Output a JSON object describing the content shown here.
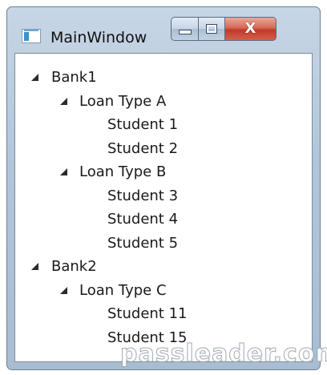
{
  "window": {
    "title": "MainWindow",
    "icon": "app-window-icon",
    "buttons": {
      "minimize": "minimize-icon",
      "maximize": "maximize-icon",
      "close": "close-icon",
      "close_glyph": "X"
    }
  },
  "tree": {
    "items": [
      {
        "label": "Bank1",
        "level": 0,
        "expanded": true
      },
      {
        "label": "Loan Type A",
        "level": 1,
        "expanded": true
      },
      {
        "label": "Student 1",
        "level": 2
      },
      {
        "label": "Student 2",
        "level": 2
      },
      {
        "label": "Loan Type B",
        "level": 1,
        "expanded": true
      },
      {
        "label": "Student 3",
        "level": 2
      },
      {
        "label": "Student 4",
        "level": 2
      },
      {
        "label": "Student 5",
        "level": 2
      },
      {
        "label": "Bank2",
        "level": 0,
        "expanded": true
      },
      {
        "label": "Loan Type C",
        "level": 1,
        "expanded": true
      },
      {
        "label": "Student 11",
        "level": 2
      },
      {
        "label": "Student 15",
        "level": 2
      }
    ]
  },
  "watermark": "passleader.com",
  "colors": {
    "titlebar": "#b3c6da",
    "close_button": "#c0392b",
    "client_background": "#ffffff"
  }
}
